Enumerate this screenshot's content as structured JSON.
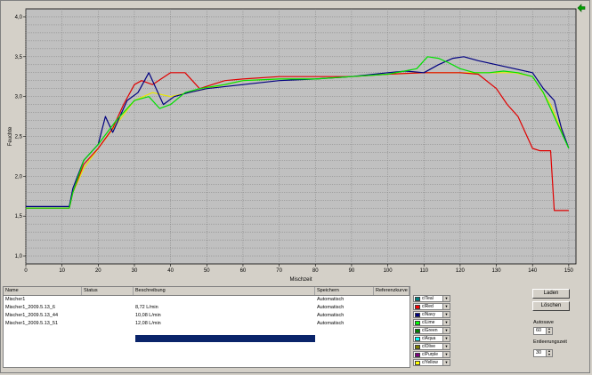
{
  "chart_data": {
    "type": "line",
    "title": "",
    "xlabel": "Mischzeit",
    "ylabel": "Feuchte",
    "xlim": [
      0,
      152
    ],
    "ylim": [
      0.9,
      4.1
    ],
    "xticks": [
      0,
      10,
      20,
      30,
      40,
      50,
      60,
      70,
      80,
      90,
      100,
      110,
      120,
      130,
      140,
      150
    ],
    "yticks": [
      1.0,
      1.5,
      2.0,
      2.5,
      3.0,
      3.5,
      4.0
    ],
    "ytick_labels": [
      "1,0",
      "1,5",
      "2,0",
      "2,5",
      "3,0",
      "3,5",
      "4,0"
    ],
    "grid": true,
    "series": [
      {
        "color": "#e8e800",
        "x": [
          0,
          12,
          13,
          16,
          20,
          25,
          30,
          35,
          40,
          45,
          50,
          60,
          70,
          80,
          90,
          100,
          110,
          115,
          120,
          125,
          130,
          135,
          140,
          145,
          150
        ],
        "y": [
          1.6,
          1.6,
          1.8,
          2.1,
          2.35,
          2.65,
          2.95,
          3.05,
          3.0,
          3.05,
          3.1,
          3.2,
          3.22,
          3.22,
          3.25,
          3.28,
          3.3,
          3.3,
          3.3,
          3.3,
          3.3,
          3.3,
          3.25,
          2.9,
          2.35
        ]
      },
      {
        "color": "#e00000",
        "x": [
          0,
          12,
          13,
          16,
          20,
          24,
          27,
          30,
          32,
          35,
          40,
          44,
          48,
          55,
          60,
          70,
          80,
          90,
          100,
          110,
          120,
          125,
          130,
          133,
          136,
          140,
          142,
          145,
          146,
          150
        ],
        "y": [
          1.6,
          1.6,
          1.8,
          2.15,
          2.35,
          2.6,
          2.9,
          3.15,
          3.2,
          3.15,
          3.3,
          3.3,
          3.1,
          3.2,
          3.22,
          3.25,
          3.25,
          3.25,
          3.28,
          3.3,
          3.3,
          3.28,
          3.1,
          2.9,
          2.75,
          2.35,
          2.32,
          2.32,
          1.57,
          1.57
        ]
      },
      {
        "color": "#000080",
        "x": [
          0,
          12,
          13,
          16,
          20,
          22,
          24,
          26,
          28,
          31,
          34,
          36,
          38,
          41,
          45,
          50,
          60,
          70,
          80,
          90,
          100,
          105,
          110,
          114,
          118,
          121,
          125,
          130,
          135,
          140,
          143,
          146,
          148,
          150
        ],
        "y": [
          1.62,
          1.62,
          1.85,
          2.2,
          2.4,
          2.75,
          2.55,
          2.75,
          2.95,
          3.05,
          3.3,
          3.1,
          2.9,
          3.0,
          3.05,
          3.1,
          3.15,
          3.2,
          3.22,
          3.25,
          3.3,
          3.32,
          3.3,
          3.4,
          3.48,
          3.5,
          3.45,
          3.4,
          3.35,
          3.3,
          3.1,
          2.95,
          2.6,
          2.35
        ]
      },
      {
        "color": "#00e000",
        "x": [
          0,
          12,
          13,
          16,
          20,
          25,
          30,
          34,
          37,
          40,
          44,
          48,
          55,
          60,
          70,
          80,
          90,
          100,
          108,
          111,
          114,
          117,
          120,
          124,
          128,
          132,
          136,
          140,
          143,
          146,
          150
        ],
        "y": [
          1.6,
          1.6,
          1.8,
          2.2,
          2.4,
          2.7,
          2.95,
          3.0,
          2.85,
          2.9,
          3.05,
          3.1,
          3.15,
          3.2,
          3.22,
          3.22,
          3.25,
          3.28,
          3.35,
          3.5,
          3.48,
          3.42,
          3.35,
          3.3,
          3.3,
          3.32,
          3.3,
          3.25,
          3.05,
          2.75,
          2.35
        ]
      }
    ]
  },
  "table": {
    "headers": [
      "Name",
      "Status",
      "Beschreibung",
      "Speichern",
      "Referenzkurve"
    ],
    "rows": [
      [
        "Mischer1",
        "",
        "",
        "Automatisch",
        ""
      ],
      [
        "Mischer1_2009.5.13_6",
        "",
        "8,72 L/min",
        "Automatisch",
        ""
      ],
      [
        "Mischer1_2009.5.13_44",
        "",
        "10,08 L/min",
        "Automatisch",
        ""
      ],
      [
        "Mischer1_2009.5.13_51",
        "",
        "12,08 L/min",
        "Automatisch",
        ""
      ]
    ]
  },
  "color_boxes": [
    {
      "label": "clTeal",
      "color": "#008080"
    },
    {
      "label": "clRed",
      "color": "#ff0000"
    },
    {
      "label": "clNavy",
      "color": "#000080"
    },
    {
      "label": "clLime",
      "color": "#00ff00"
    },
    {
      "label": "clGreen",
      "color": "#008000"
    },
    {
      "label": "clAqua",
      "color": "#00ffff"
    },
    {
      "label": "clOlive",
      "color": "#808000"
    },
    {
      "label": "clPurple",
      "color": "#800080"
    },
    {
      "label": "clYellow",
      "color": "#ffff00"
    }
  ],
  "controls": {
    "laden_label": "Laden",
    "loeschen_label": "Löschen",
    "autosave_label": "Autosave",
    "autosave_value": "60",
    "entleerungszeit_label": "Entleerungszeit",
    "entleerungszeit_value": "30"
  },
  "icons": {
    "corner": "green-arrow-icon",
    "dropdown": "dropdown-arrow-icon",
    "spin": "spin-arrows-icon"
  }
}
